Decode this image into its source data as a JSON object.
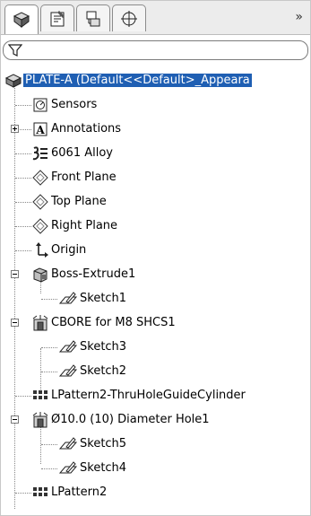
{
  "tabs": [
    {
      "icon": "feature-manager-icon",
      "active": true
    },
    {
      "icon": "property-manager-icon",
      "active": false
    },
    {
      "icon": "configuration-manager-icon",
      "active": false
    },
    {
      "icon": "dimxpert-manager-icon",
      "active": false
    }
  ],
  "more_label": "»",
  "tree": {
    "root": {
      "label": "PLATE-A  (Default<<Default>_Appeara",
      "icon": "part-icon"
    },
    "items": [
      {
        "label": "Sensors",
        "icon": "sensors-icon"
      },
      {
        "label": "Annotations",
        "icon": "annotations-icon",
        "expander": "plus"
      },
      {
        "label": "6061 Alloy",
        "icon": "material-icon"
      },
      {
        "label": "Front Plane",
        "icon": "plane-icon"
      },
      {
        "label": "Top Plane",
        "icon": "plane-icon"
      },
      {
        "label": "Right Plane",
        "icon": "plane-icon"
      },
      {
        "label": "Origin",
        "icon": "origin-icon"
      },
      {
        "label": "Boss-Extrude1",
        "icon": "extrude-icon",
        "expander": "minus"
      },
      {
        "label": "Sketch1",
        "icon": "sketch-icon"
      },
      {
        "label": "CBORE for M8 SHCS1",
        "icon": "hole-wizard-icon",
        "expander": "minus"
      },
      {
        "label": "Sketch3",
        "icon": "sketch-icon"
      },
      {
        "label": "Sketch2",
        "icon": "sketch-icon"
      },
      {
        "label": "LPattern2-ThruHoleGuideCylinder",
        "icon": "linear-pattern-icon"
      },
      {
        "label": "Ø10.0 (10) Diameter Hole1",
        "icon": "hole-wizard-icon",
        "expander": "minus"
      },
      {
        "label": "Sketch5",
        "icon": "sketch-icon"
      },
      {
        "label": "Sketch4",
        "icon": "sketch-icon"
      },
      {
        "label": "LPattern2",
        "icon": "linear-pattern-icon"
      }
    ]
  }
}
